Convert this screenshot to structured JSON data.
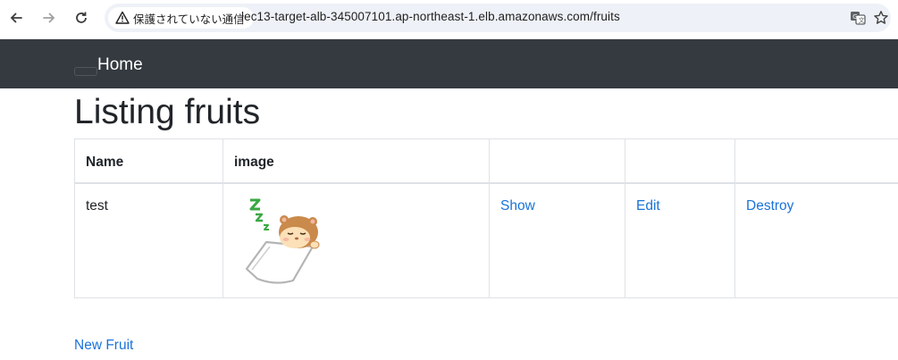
{
  "browser": {
    "security_label": "保護されていない通信",
    "url": "lec13-target-alb-345007101.ap-northeast-1.elb.amazonaws.com/fruits",
    "icons": [
      "back-icon",
      "forward-icon",
      "reload-icon",
      "warning-icon",
      "translate-icon",
      "star-icon"
    ]
  },
  "navbar": {
    "brand": "Home"
  },
  "page": {
    "title": "Listing fruits",
    "columns": [
      "Name",
      "image",
      "",
      "",
      ""
    ],
    "rows": [
      {
        "name": "test",
        "image_alt": "sleeping hamster",
        "show": "Show",
        "edit": "Edit",
        "destroy": "Destroy"
      }
    ],
    "new_link": "New Fruit"
  },
  "colors": {
    "navbar_bg": "#343a40",
    "link": "#1a73d8",
    "text": "#212529"
  }
}
